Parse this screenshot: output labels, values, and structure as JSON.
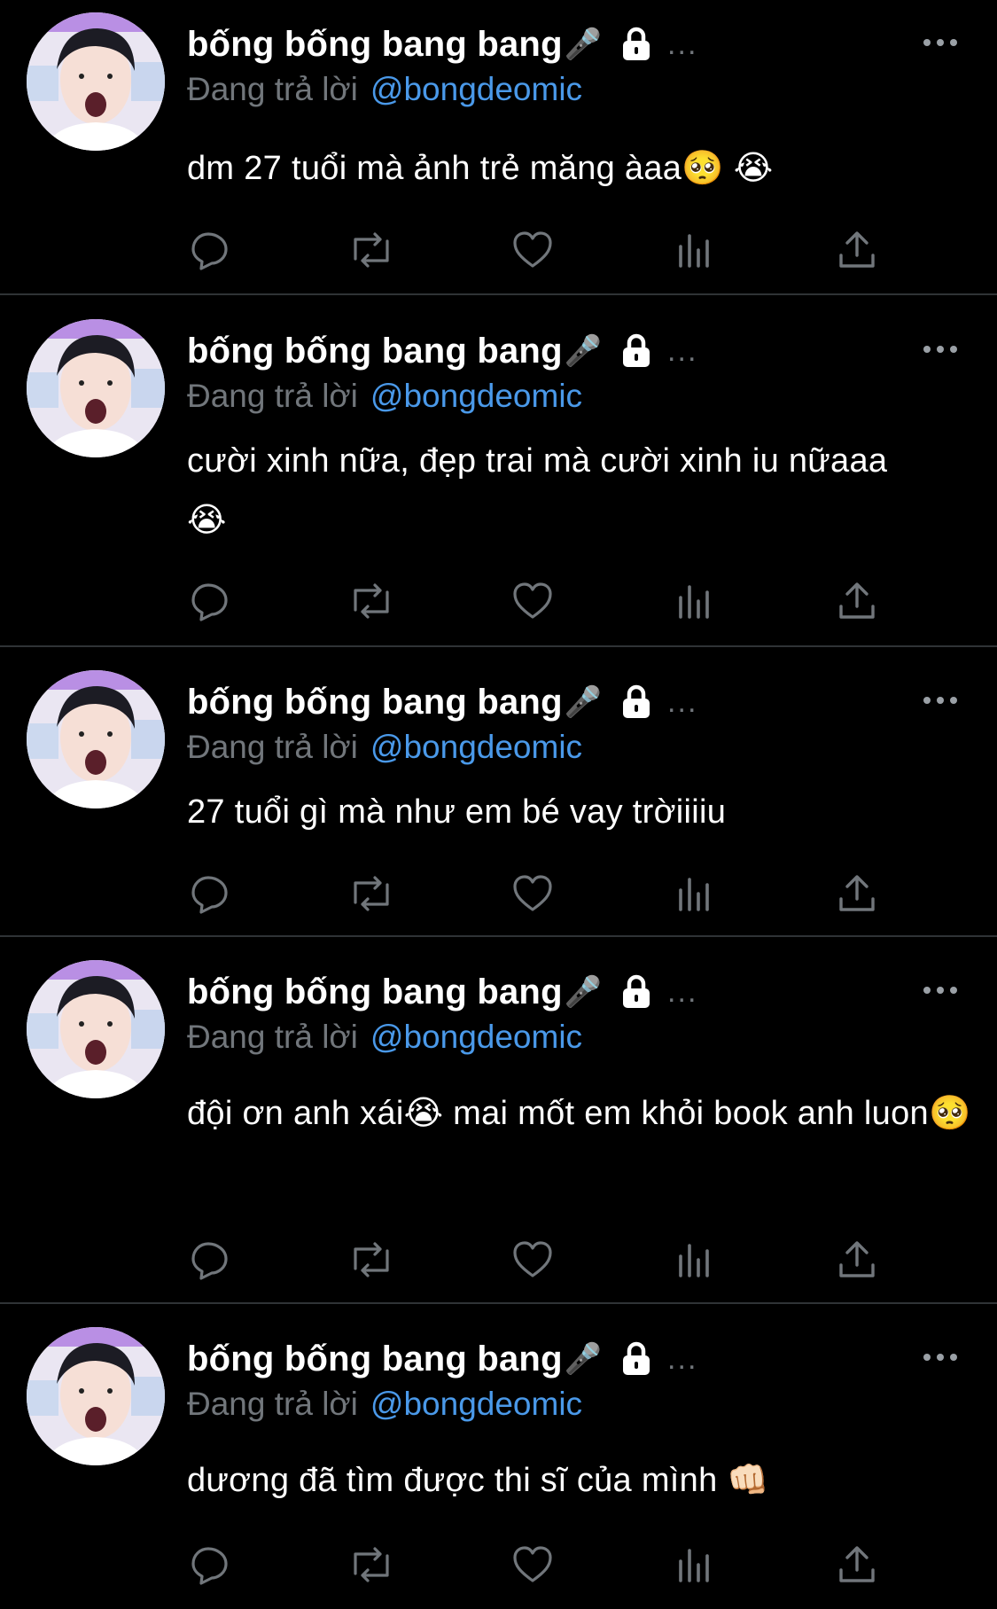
{
  "theme": {
    "background": "#000000",
    "text": "#ffffff",
    "muted": "#71767b",
    "link": "#4a99e9",
    "divider": "#2f3336",
    "avatar_bg": "#e9e4f3"
  },
  "icons": {
    "reply": "speech-bubble",
    "retweet": "repeat-arrows",
    "like": "heart",
    "views": "bar-chart",
    "share": "upload-arrow",
    "more": "three-dots",
    "lock": "padlock",
    "mic": "microphone"
  },
  "tweets": [
    {
      "display_name": "bống bống bang bang",
      "mic": "🎤",
      "trail": "...",
      "reply_prefix": "Đang trả lời",
      "reply_handle": "@bongdeomic",
      "text": "dm 27 tuổi mà ảnh trẻ măng àaa🥺 😭"
    },
    {
      "display_name": "bống bống bang bang",
      "mic": "🎤",
      "trail": "...",
      "reply_prefix": "Đang trả lời",
      "reply_handle": "@bongdeomic",
      "text": "cười xinh nữa, đẹp trai mà cười xinh iu nữaaa😭"
    },
    {
      "display_name": "bống bống bang bang",
      "mic": "🎤",
      "trail": "...",
      "reply_prefix": "Đang trả lời",
      "reply_handle": "@bongdeomic",
      "text": "27 tuổi gì mà như em bé vay trờiiiiu"
    },
    {
      "display_name": "bống bống bang bang",
      "mic": "🎤",
      "trail": "...",
      "reply_prefix": "Đang trả lời",
      "reply_handle": "@bongdeomic",
      "text": "đội ơn anh xái😭  mai mốt em khỏi book anh luon🥺"
    },
    {
      "display_name": "bống bống bang bang",
      "mic": "🎤",
      "trail": "...",
      "reply_prefix": "Đang trả lời",
      "reply_handle": "@bongdeomic",
      "text": "dương đã tìm được thi sĩ của mình 👊🏻"
    }
  ]
}
